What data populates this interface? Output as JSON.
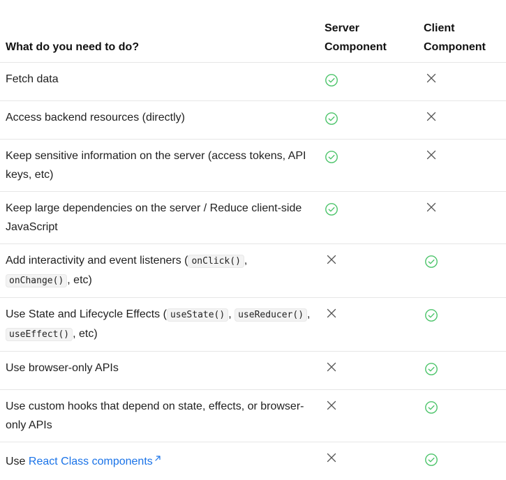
{
  "headers": {
    "feature": "What do you need to do?",
    "server": [
      "Server",
      "Component"
    ],
    "client": [
      "Client",
      "Component"
    ]
  },
  "icons": {
    "check": "check-circle-icon",
    "cross": "cross-icon",
    "external": "external-link-icon"
  },
  "colors": {
    "check": "#4cc46a",
    "cross": "#555555",
    "link": "#1a73e8"
  },
  "rows": [
    {
      "parts": [
        {
          "t": "Fetch data"
        }
      ],
      "server": true,
      "client": false
    },
    {
      "parts": [
        {
          "t": "Access backend resources (directly)"
        }
      ],
      "server": true,
      "client": false
    },
    {
      "parts": [
        {
          "t": "Keep sensitive information on the server (access tokens, API keys, etc)"
        }
      ],
      "server": true,
      "client": false
    },
    {
      "parts": [
        {
          "t": "Keep large dependencies on the server / Reduce client-side JavaScript"
        }
      ],
      "server": true,
      "client": false
    },
    {
      "parts": [
        {
          "t": "Add interactivity and event listeners ("
        },
        {
          "code": "onClick()"
        },
        {
          "t": ", "
        },
        {
          "code": "onChange()"
        },
        {
          "t": ", etc)"
        }
      ],
      "server": false,
      "client": true
    },
    {
      "parts": [
        {
          "t": "Use State and Lifecycle Effects ("
        },
        {
          "code": "useState()"
        },
        {
          "t": ", "
        },
        {
          "code": "useReducer()"
        },
        {
          "t": ", "
        },
        {
          "code": "useEffect()"
        },
        {
          "t": ", etc)"
        }
      ],
      "server": false,
      "client": true
    },
    {
      "parts": [
        {
          "t": "Use browser-only APIs"
        }
      ],
      "server": false,
      "client": true
    },
    {
      "parts": [
        {
          "t": "Use custom hooks that depend on state, effects, or browser-only APIs"
        }
      ],
      "server": false,
      "client": true
    },
    {
      "parts": [
        {
          "t": "Use "
        },
        {
          "link": "React Class components"
        }
      ],
      "server": false,
      "client": true
    }
  ]
}
